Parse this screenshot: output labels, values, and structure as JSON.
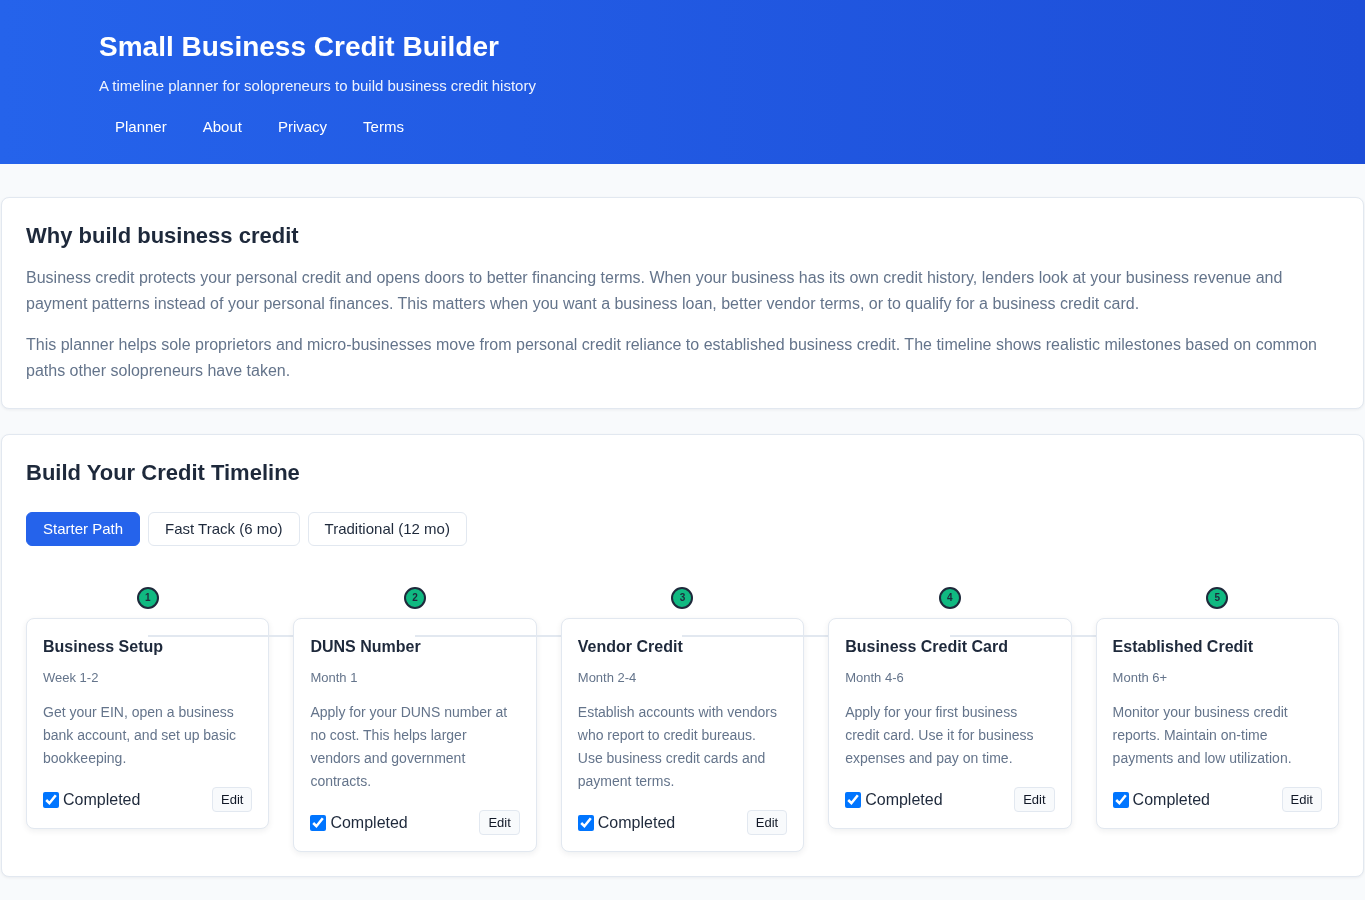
{
  "header": {
    "title": "Small Business Credit Builder",
    "subtitle": "A timeline planner for solopreneurs to build business credit history",
    "nav": [
      {
        "label": "Planner"
      },
      {
        "label": "About"
      },
      {
        "label": "Privacy"
      },
      {
        "label": "Terms"
      }
    ]
  },
  "intro": {
    "heading": "Why build business credit",
    "paragraphs": [
      "Business credit protects your personal credit and opens doors to better financing terms. When your business has its own credit history, lenders look at your business revenue and payment patterns instead of your personal finances. This matters when you want a business loan, better vendor terms, or to qualify for a business credit card.",
      "This planner helps sole proprietors and micro-businesses move from personal credit reliance to established business credit. The timeline shows realistic milestones based on common paths other solopreneurs have taken."
    ]
  },
  "timeline": {
    "heading": "Build Your Credit Timeline",
    "tabs": [
      {
        "label": "Starter Path",
        "selected": true
      },
      {
        "label": "Fast Track (6 mo)",
        "selected": false
      },
      {
        "label": "Traditional (12 mo)",
        "selected": false
      }
    ],
    "steps": [
      {
        "number": "1",
        "title": "Business Setup",
        "period": "Week 1-2",
        "description": "Get your EIN, open a business bank account, and set up basic bookkeeping.",
        "completed": true,
        "completed_label": "Completed",
        "button": "Edit"
      },
      {
        "number": "2",
        "title": "DUNS Number",
        "period": "Month 1",
        "description": "Apply for your DUNS number at no cost. This helps larger vendors and government contracts.",
        "completed": true,
        "completed_label": "Completed",
        "button": "Edit"
      },
      {
        "number": "3",
        "title": "Vendor Credit",
        "period": "Month 2-4",
        "description": "Establish accounts with vendors who report to credit bureaus. Use business credit cards and payment terms.",
        "completed": true,
        "completed_label": "Completed",
        "button": "Edit"
      },
      {
        "number": "4",
        "title": "Business Credit Card",
        "period": "Month 4-6",
        "description": "Apply for your first business credit card. Use it for business expenses and pay on time.",
        "completed": true,
        "completed_label": "Completed",
        "button": "Edit"
      },
      {
        "number": "5",
        "title": "Established Credit",
        "period": "Month 6+",
        "description": "Monitor your business credit reports. Maintain on-time payments and low utilization.",
        "completed": true,
        "completed_label": "Completed",
        "button": "Edit"
      }
    ]
  }
}
